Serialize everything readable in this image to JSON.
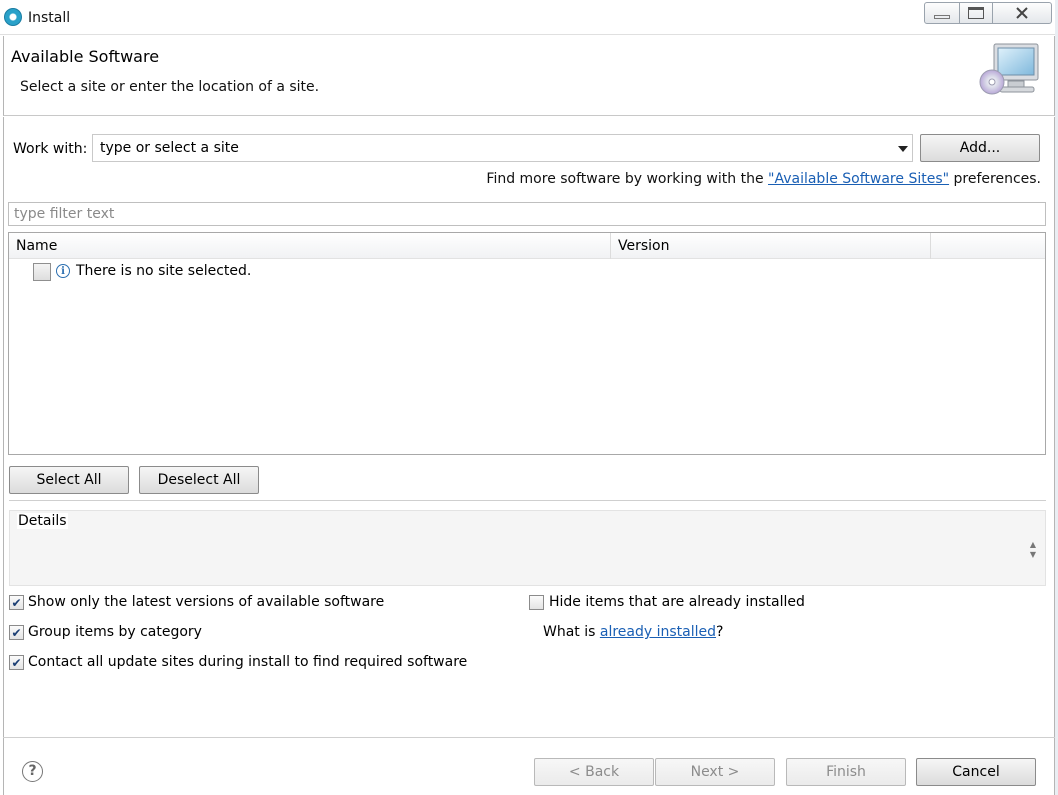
{
  "window": {
    "title": "Install",
    "controls": {
      "minimize": "minimize-icon",
      "maximize": "maximize-icon",
      "close": "close-icon"
    }
  },
  "header": {
    "title": "Available Software",
    "subtitle": "Select a site or enter the location of a site.",
    "image": "computer-cd-icon"
  },
  "work_with": {
    "label": "Work with:",
    "value": "type or select a site",
    "add_label": "Add..."
  },
  "more_software": {
    "prefix": "Find more software by working with the ",
    "link": "\"Available Software Sites\"",
    "suffix": " preferences."
  },
  "filter": {
    "placeholder": "type filter text",
    "value": ""
  },
  "table": {
    "columns": [
      "Name",
      "Version",
      ""
    ],
    "rows": [
      {
        "checked": false,
        "icon": "info-icon",
        "name": "There is no site selected.",
        "version": ""
      }
    ]
  },
  "selection": {
    "select_all": "Select All",
    "deselect_all": "Deselect All"
  },
  "details": {
    "label": "Details",
    "text": ""
  },
  "options": {
    "latest": {
      "label": "Show only the latest versions of available software",
      "checked": true
    },
    "group": {
      "label": "Group items by category",
      "checked": true
    },
    "contact": {
      "label": "Contact all update sites during install to find required software",
      "checked": true
    },
    "hide_installed": {
      "label": "Hide items that are already installed",
      "checked": false
    },
    "what_is": {
      "prefix": "What is ",
      "link": "already installed",
      "suffix": "?"
    }
  },
  "footer": {
    "help_icon": "help-icon",
    "back": "< Back",
    "next": "Next >",
    "finish": "Finish",
    "cancel": "Cancel"
  },
  "colors": {
    "link": "#1a5fb4",
    "accent": "#2aa1c9"
  }
}
